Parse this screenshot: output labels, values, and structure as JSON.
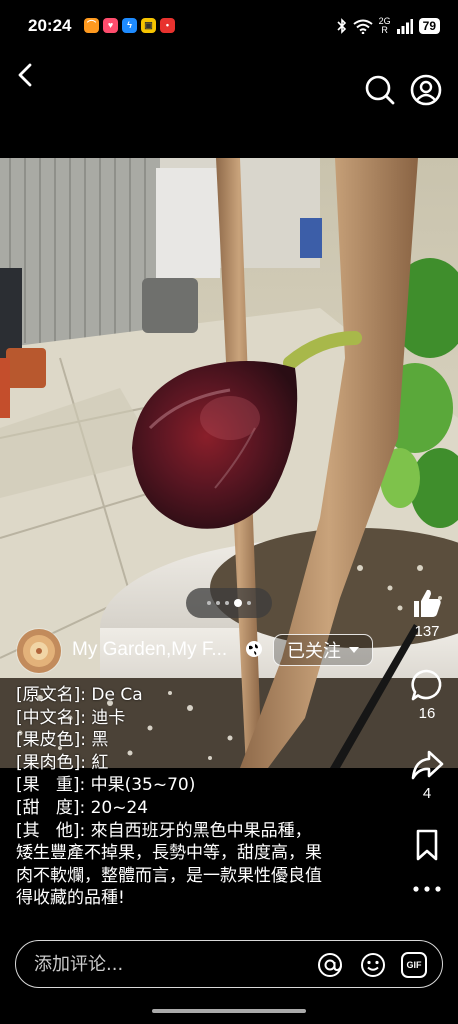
{
  "status_bar": {
    "time": "20:24",
    "notification_apps": [
      {
        "icon": "orange-app-icon",
        "color": "#ff9a1f"
      },
      {
        "icon": "red-heart-app-icon",
        "color": "#ff4d6d"
      },
      {
        "icon": "messenger-icon",
        "color": "#1e8bff"
      },
      {
        "icon": "yellow-app-icon",
        "color": "#f6c400"
      },
      {
        "icon": "red-app-icon",
        "color": "#e8322e"
      }
    ],
    "network_label": "2G",
    "network_sub": "R",
    "battery": "79"
  },
  "post": {
    "author_name": "My Garden,My F...",
    "follow_label": "已关注",
    "caption_lines": [
      "[原文名]: De Ca",
      "[中文名]: 迪卡",
      "[果皮色]: 黑",
      "[果肉色]: 紅",
      "[果   重]: 中果(35~70)",
      "[甜   度]: 20~24",
      "[其   他]: 來自西班牙的黑色中果品種，",
      "矮生豐產不掉果，長勢中等，甜度高，果",
      "肉不軟爛，整體而言，是一款果性優良值",
      "得收藏的品種!"
    ],
    "carousel": {
      "count": 5,
      "active_index": 3
    }
  },
  "actions": {
    "like_count": "137",
    "comment_count": "16",
    "share_count": "4"
  },
  "comment_bar": {
    "placeholder": "添加评论...",
    "gif_label": "GIF"
  },
  "colors": {
    "background": "#000000",
    "foreground": "#ffffff"
  }
}
